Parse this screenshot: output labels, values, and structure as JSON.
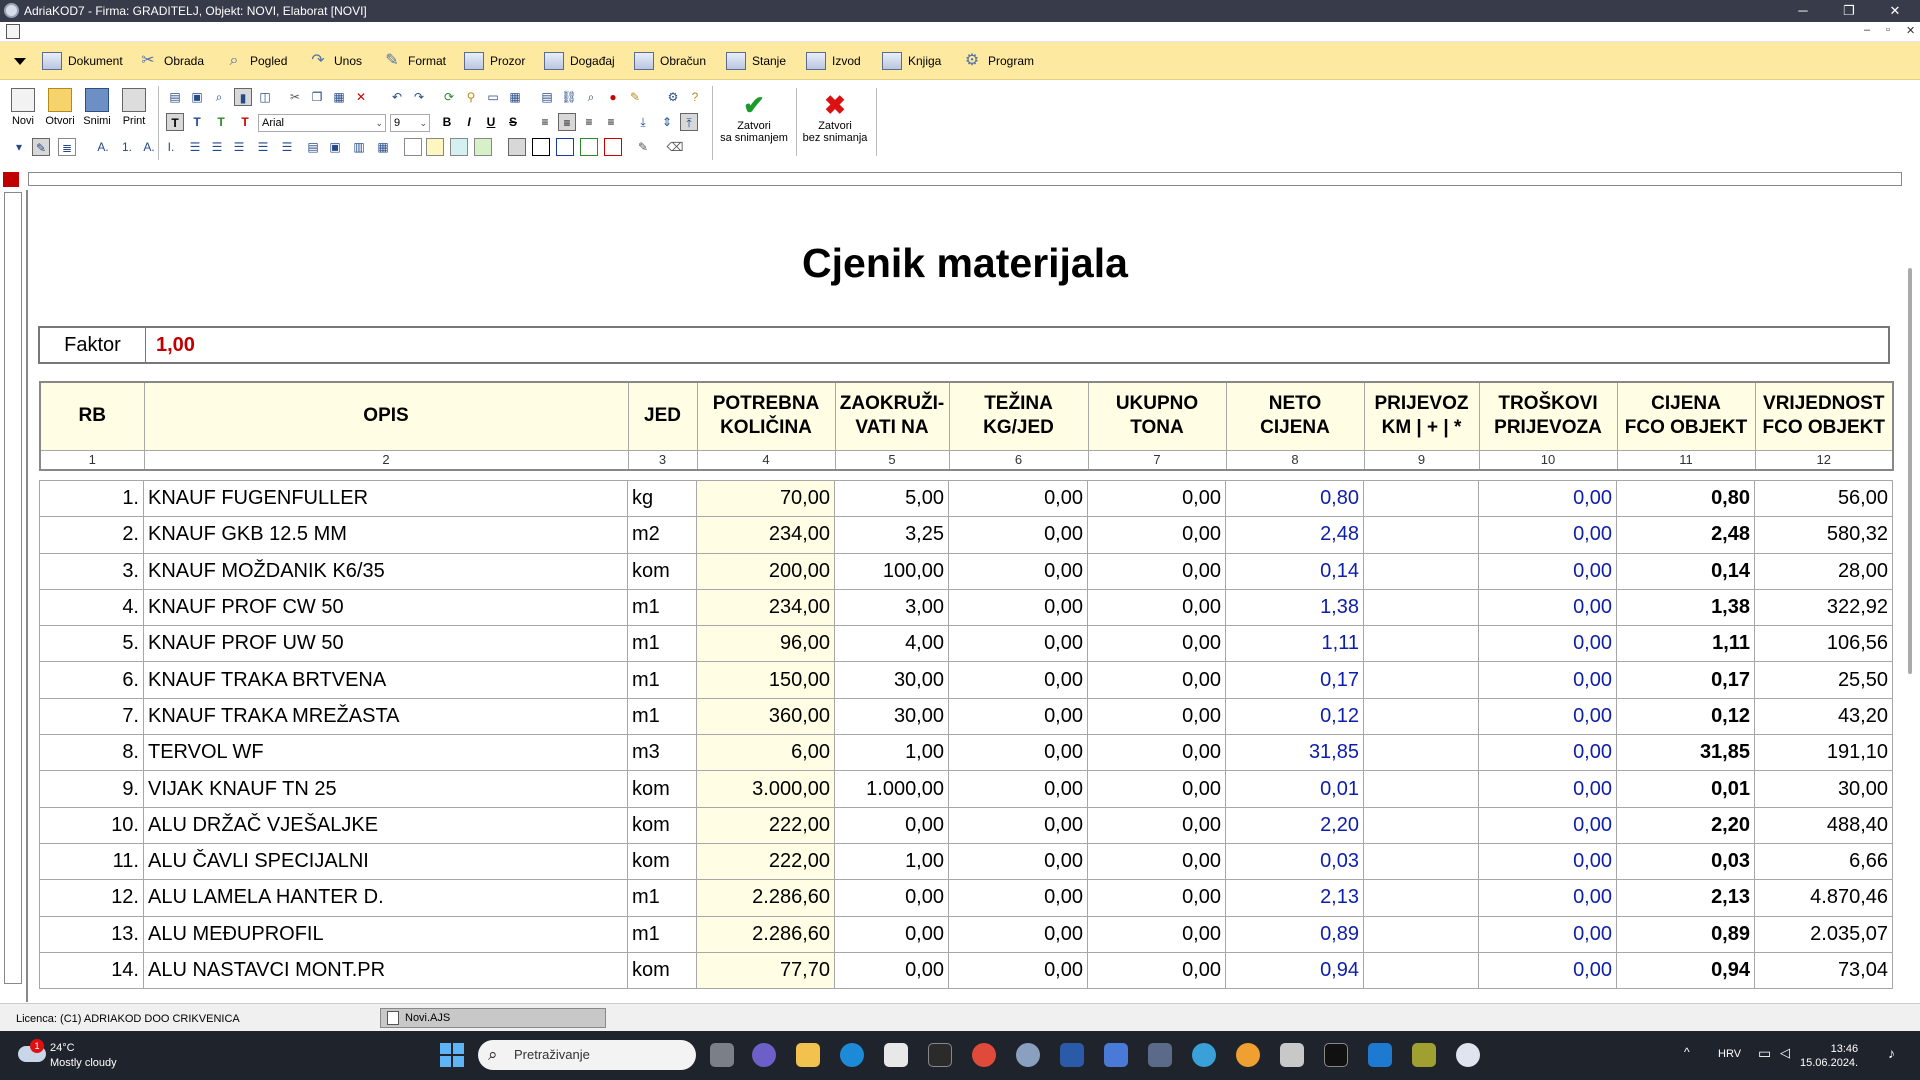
{
  "window": {
    "title": "AdriaKOD7 - Firma: GRADITELJ,   Objekt: NOVI,  Elaborat [NOVI]",
    "minimize": "─",
    "restore": "❐",
    "close": "✕"
  },
  "menu": {
    "items": [
      "Dokument",
      "Obrada",
      "Pogled",
      "Unos",
      "Format",
      "Prozor",
      "Događaj",
      "Obračun",
      "Stanje",
      "Izvod",
      "Knjiga",
      "Program"
    ]
  },
  "toolbar": {
    "new_label": "Novi",
    "open_label": "Otvori",
    "save_label": "Snimi",
    "print_label": "Print",
    "font_name": "Arial",
    "font_size": "9",
    "bold": "B",
    "italic": "I",
    "underline": "U",
    "strike": "S",
    "save_close_line1": "Zatvori",
    "save_close_line2": "sa snimanjem",
    "close_nosave_line1": "Zatvori",
    "close_nosave_line2": "bez snimanja"
  },
  "document": {
    "title": "Cjenik materijala",
    "factor_label": "Faktor",
    "factor_value": "1,00"
  },
  "table": {
    "headers": [
      [
        "RB",
        ""
      ],
      [
        "OPIS",
        ""
      ],
      [
        "JED",
        ""
      ],
      [
        "POTREBNA",
        "KOLIČINA"
      ],
      [
        "ZAOKRUŽI-",
        "VATI NA"
      ],
      [
        "TEŽINA",
        "KG/JED"
      ],
      [
        "UKUPNO",
        "TONA"
      ],
      [
        "NETO",
        "CIJENA"
      ],
      [
        "PRIJEVOZ",
        "KM | + | *"
      ],
      [
        "TROŠKOVI",
        "PRIJEVOZA"
      ],
      [
        "CIJENA",
        "FCO OBJEKT"
      ],
      [
        "VRIJEDNOST",
        "FCO OBJEKT"
      ]
    ],
    "column_numbers": [
      "1",
      "2",
      "3",
      "4",
      "5",
      "6",
      "7",
      "8",
      "9",
      "10",
      "11",
      "12"
    ],
    "rows": [
      [
        "1.",
        "KNAUF FUGENFULLER",
        "kg",
        "70,00",
        "5,00",
        "0,00",
        "0,00",
        "0,80",
        "",
        "0,00",
        "0,80",
        "56,00"
      ],
      [
        "2.",
        "KNAUF GKB 12.5 MM",
        "m2",
        "234,00",
        "3,25",
        "0,00",
        "0,00",
        "2,48",
        "",
        "0,00",
        "2,48",
        "580,32"
      ],
      [
        "3.",
        "KNAUF MOŽDANIK K6/35",
        "kom",
        "200,00",
        "100,00",
        "0,00",
        "0,00",
        "0,14",
        "",
        "0,00",
        "0,14",
        "28,00"
      ],
      [
        "4.",
        "KNAUF PROF CW 50",
        "m1",
        "234,00",
        "3,00",
        "0,00",
        "0,00",
        "1,38",
        "",
        "0,00",
        "1,38",
        "322,92"
      ],
      [
        "5.",
        "KNAUF PROF UW 50",
        "m1",
        "96,00",
        "4,00",
        "0,00",
        "0,00",
        "1,11",
        "",
        "0,00",
        "1,11",
        "106,56"
      ],
      [
        "6.",
        "KNAUF TRAKA BRTVENA",
        "m1",
        "150,00",
        "30,00",
        "0,00",
        "0,00",
        "0,17",
        "",
        "0,00",
        "0,17",
        "25,50"
      ],
      [
        "7.",
        "KNAUF TRAKA MREŽASTA",
        "m1",
        "360,00",
        "30,00",
        "0,00",
        "0,00",
        "0,12",
        "",
        "0,00",
        "0,12",
        "43,20"
      ],
      [
        "8.",
        "TERVOL WF",
        "m3",
        "6,00",
        "1,00",
        "0,00",
        "0,00",
        "31,85",
        "",
        "0,00",
        "31,85",
        "191,10"
      ],
      [
        "9.",
        "VIJAK KNAUF TN 25",
        "kom",
        "3.000,00",
        "1.000,00",
        "0,00",
        "0,00",
        "0,01",
        "",
        "0,00",
        "0,01",
        "30,00"
      ],
      [
        "10.",
        "ALU DRŽAČ VJEŠALJKE",
        "kom",
        "222,00",
        "0,00",
        "0,00",
        "0,00",
        "2,20",
        "",
        "0,00",
        "2,20",
        "488,40"
      ],
      [
        "11.",
        "ALU ČAVLI SPECIJALNI",
        "kom",
        "222,00",
        "1,00",
        "0,00",
        "0,00",
        "0,03",
        "",
        "0,00",
        "0,03",
        "6,66"
      ],
      [
        "12.",
        "ALU LAMELA HANTER D.",
        "m1",
        "2.286,60",
        "0,00",
        "0,00",
        "0,00",
        "2,13",
        "",
        "0,00",
        "2,13",
        "4.870,46"
      ],
      [
        "13.",
        "ALU MEĐUPROFIL",
        "m1",
        "2.286,60",
        "0,00",
        "0,00",
        "0,00",
        "0,89",
        "",
        "0,00",
        "0,89",
        "2.035,07"
      ],
      [
        "14.",
        "ALU NASTAVCI MONT.PR",
        "kom",
        "77,70",
        "0,00",
        "0,00",
        "0,00",
        "0,94",
        "",
        "0,00",
        "0,94",
        "73,04"
      ]
    ]
  },
  "statusbar": {
    "license": "Licenca:  (C1) ADRIAKOD DOO CRIKVENICA",
    "doc_tab": "Novi.AJS"
  },
  "taskbar": {
    "temperature": "24°C",
    "weather": "Mostly cloudy",
    "badge": "1",
    "search_placeholder": "Pretraživanje",
    "language": "HRV",
    "time": "13:46",
    "date": "15.06.2024."
  },
  "colors": {
    "menu_bg": "#fde9a0",
    "header_bg": "#fffde3",
    "factor_value": "#c00000",
    "price_blue": "#0d1eaa",
    "titlebar": "#383c4a",
    "taskbar": "#1f242c"
  }
}
